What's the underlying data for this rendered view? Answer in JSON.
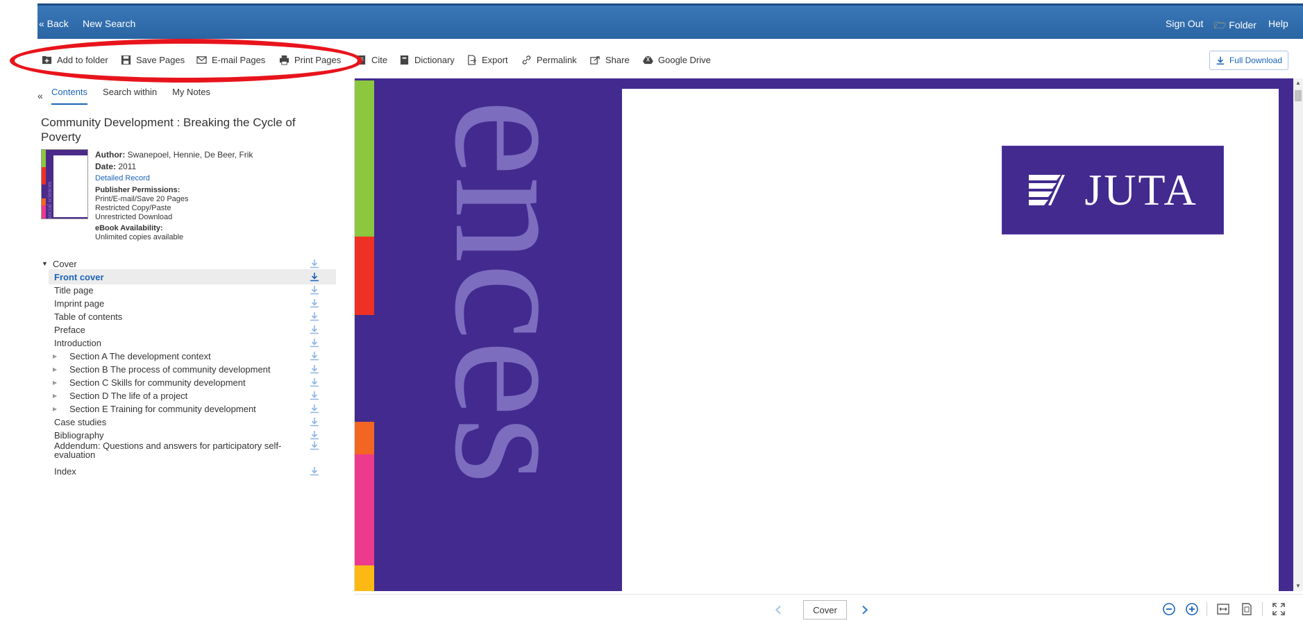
{
  "topbar": {
    "back": "« Back",
    "new_search": "New Search",
    "sign_out": "Sign Out",
    "folder": "Folder",
    "help": "Help"
  },
  "toolbar": {
    "add_to_folder": "Add to folder",
    "save_pages": "Save Pages",
    "email_pages": "E-mail Pages",
    "print_pages": "Print Pages",
    "cite": "Cite",
    "dictionary": "Dictionary",
    "export": "Export",
    "permalink": "Permalink",
    "share": "Share",
    "google_drive": "Google Drive",
    "full_download": "Full Download"
  },
  "sidebar": {
    "collapse": "«",
    "tabs": [
      "Contents",
      "Search within",
      "My Notes"
    ],
    "book_title": "Community Development : Breaking the Cycle of Poverty",
    "thumbnail_text": "social sciences",
    "author_label": "Author:",
    "author": "Swanepoel, Hennie, De Beer, Frik",
    "date_label": "Date:",
    "date": "2011",
    "detailed_record": "Detailed Record",
    "permissions_label": "Publisher Permissions:",
    "permissions": [
      "Print/E-mail/Save 20 Pages",
      "Restricted Copy/Paste",
      "Unrestricted Download"
    ],
    "availability_label": "eBook Availability:",
    "availability": "Unlimited copies available"
  },
  "toc": [
    {
      "label": "Cover",
      "level": 0,
      "expanded": true
    },
    {
      "label": "Front cover",
      "level": 1,
      "active": true
    },
    {
      "label": "Title page",
      "level": 1
    },
    {
      "label": "Imprint page",
      "level": 1
    },
    {
      "label": "Table of contents",
      "level": 1
    },
    {
      "label": "Preface",
      "level": 1
    },
    {
      "label": "Introduction",
      "level": 1
    },
    {
      "label": "Section A The development context",
      "level": 1,
      "expandable": true
    },
    {
      "label": "Section B The process of community development",
      "level": 1,
      "expandable": true
    },
    {
      "label": "Section C Skills for community development",
      "level": 1,
      "expandable": true
    },
    {
      "label": "Section D The life of a project",
      "level": 1,
      "expandable": true
    },
    {
      "label": "Section E Training for community development",
      "level": 1,
      "expandable": true
    },
    {
      "label": "Case studies",
      "level": 1
    },
    {
      "label": "Bibliography",
      "level": 1
    },
    {
      "label": "Addendum: Questions and answers for participatory self-evaluation",
      "level": 1,
      "multiline": true
    },
    {
      "label": "Index",
      "level": 1
    }
  ],
  "viewer": {
    "cover_word": "ences",
    "logo_text": "JUTA",
    "current_page": "Cover"
  },
  "colors": {
    "accent": "#1a63b8",
    "topbar": "#2a64a3",
    "cover_purple": "#422a8f",
    "highlight": "#e8141c",
    "strip": [
      "#8dc63f",
      "#ee3124",
      "#422a8f",
      "#f26522",
      "#ec3a8c",
      "#fdb913"
    ]
  }
}
